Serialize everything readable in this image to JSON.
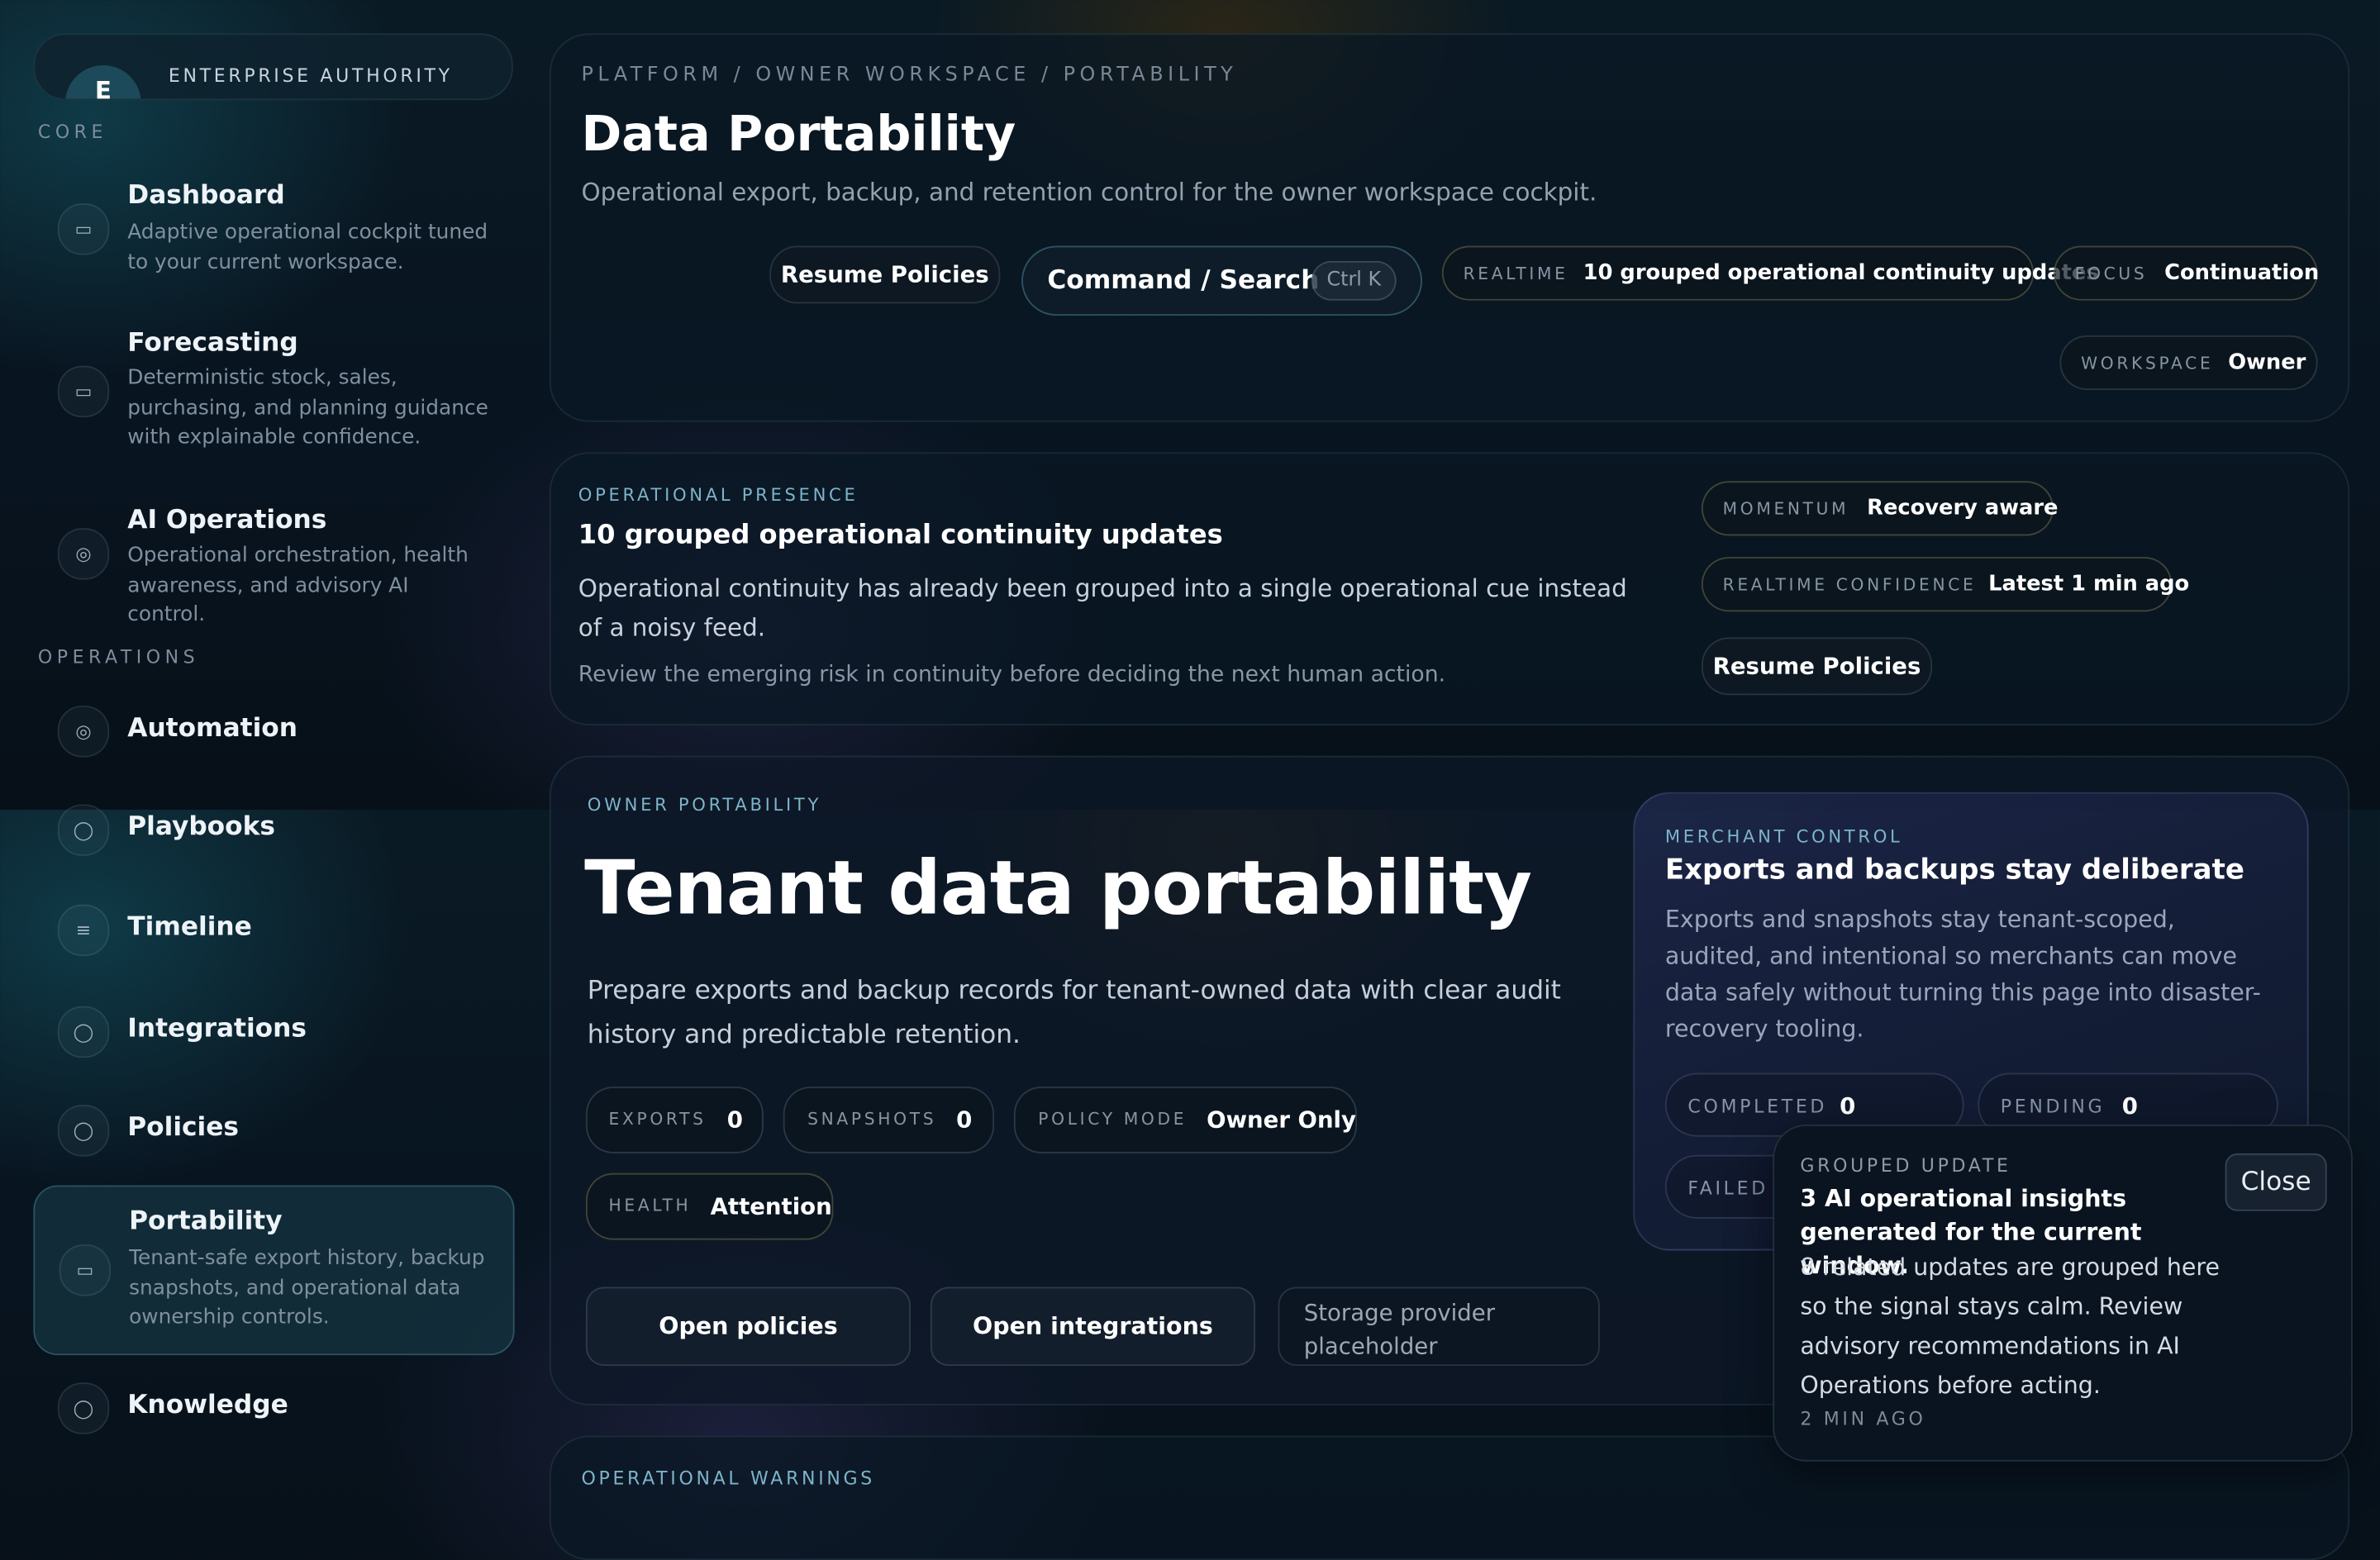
{
  "sidebar": {
    "brand": {
      "avatar_letter": "E",
      "label": "ENTERPRISE AUTHORITY"
    },
    "sections": {
      "core": "CORE",
      "operations": "OPERATIONS"
    },
    "items": [
      {
        "title": "Dashboard",
        "desc": "Adaptive operational cockpit tuned to your current workspace.",
        "icon": "bar-chart-icon"
      },
      {
        "title": "Forecasting",
        "desc": "Deterministic stock, sales, purchasing, and planning guidance with explainable confidence.",
        "icon": "bar-chart-icon"
      },
      {
        "title": "AI Operations",
        "desc": "Operational orchestration, health awareness, and advisory AI control.",
        "icon": "target-icon"
      },
      {
        "title": "Automation",
        "icon": "target-icon"
      },
      {
        "title": "Playbooks",
        "icon": "compass-icon"
      },
      {
        "title": "Timeline",
        "icon": "list-icon"
      },
      {
        "title": "Integrations",
        "icon": "compass-icon"
      },
      {
        "title": "Policies",
        "icon": "compass-icon"
      },
      {
        "title": "Portability",
        "desc": "Tenant-safe export history, backup snapshots, and operational data ownership controls.",
        "icon": "bar-chart-icon",
        "active": true
      },
      {
        "title": "Knowledge",
        "icon": "compass-icon"
      }
    ]
  },
  "header": {
    "breadcrumb": "PLATFORM / OWNER WORKSPACE / PORTABILITY",
    "title": "Data Portability",
    "subtitle": "Operational export, backup, and retention control for the owner workspace cockpit.",
    "resume_button": "Resume Policies",
    "command_label": "Command / Search",
    "command_shortcut": "Ctrl K",
    "realtime": {
      "key": "REALTIME",
      "value": "10 grouped operational continuity updates"
    },
    "focus": {
      "key": "FOCUS",
      "value": "Continuation"
    },
    "workspace": {
      "key": "WORKSPACE",
      "value": "Owner"
    }
  },
  "presence": {
    "eyebrow": "OPERATIONAL PRESENCE",
    "title": "10 grouped operational continuity updates",
    "body": "Operational continuity has already been grouped into a single operational cue instead of a noisy feed.",
    "note": "Review the emerging risk in continuity before deciding the next human action.",
    "momentum": {
      "key": "MOMENTUM",
      "value": "Recovery aware"
    },
    "confidence": {
      "key": "REALTIME CONFIDENCE",
      "value": "Latest 1 min ago"
    },
    "resume_button": "Resume Policies"
  },
  "portability": {
    "eyebrow": "OWNER PORTABILITY",
    "title": "Tenant data portability",
    "body": "Prepare exports and backup records for tenant-owned data with clear audit history and predictable retention.",
    "stats": {
      "exports": {
        "key": "EXPORTS",
        "value": "0"
      },
      "snapshots": {
        "key": "SNAPSHOTS",
        "value": "0"
      },
      "policy_mode": {
        "key": "POLICY MODE",
        "value": "Owner Only"
      },
      "health": {
        "key": "HEALTH",
        "value": "Attention"
      }
    },
    "buttons": {
      "open_policies": "Open policies",
      "open_integrations": "Open integrations",
      "storage": "Storage provider placeholder"
    }
  },
  "merchant": {
    "eyebrow": "MERCHANT CONTROL",
    "title": "Exports and backups stay deliberate",
    "body": "Exports and snapshots stay tenant-scoped, audited, and intentional so merchants can move data safely without turning this page into disaster-recovery tooling.",
    "completed": {
      "key": "COMPLETED",
      "value": "0"
    },
    "pending": {
      "key": "PENDING",
      "value": "0"
    },
    "failed": {
      "key": "FAILED"
    }
  },
  "toast": {
    "eyebrow": "GROUPED UPDATE",
    "title": "3 AI operational insights generated for the current window.",
    "body": "8 related updates are grouped here so the signal stays calm. Review advisory recommendations in AI Operations before acting.",
    "time": "2 MIN AGO",
    "close": "Close"
  },
  "warnings": {
    "eyebrow": "OPERATIONAL WARNINGS"
  },
  "colors": {
    "accent": "#7cb4c9",
    "pill_border": "#aaa064",
    "background": "#081420"
  }
}
